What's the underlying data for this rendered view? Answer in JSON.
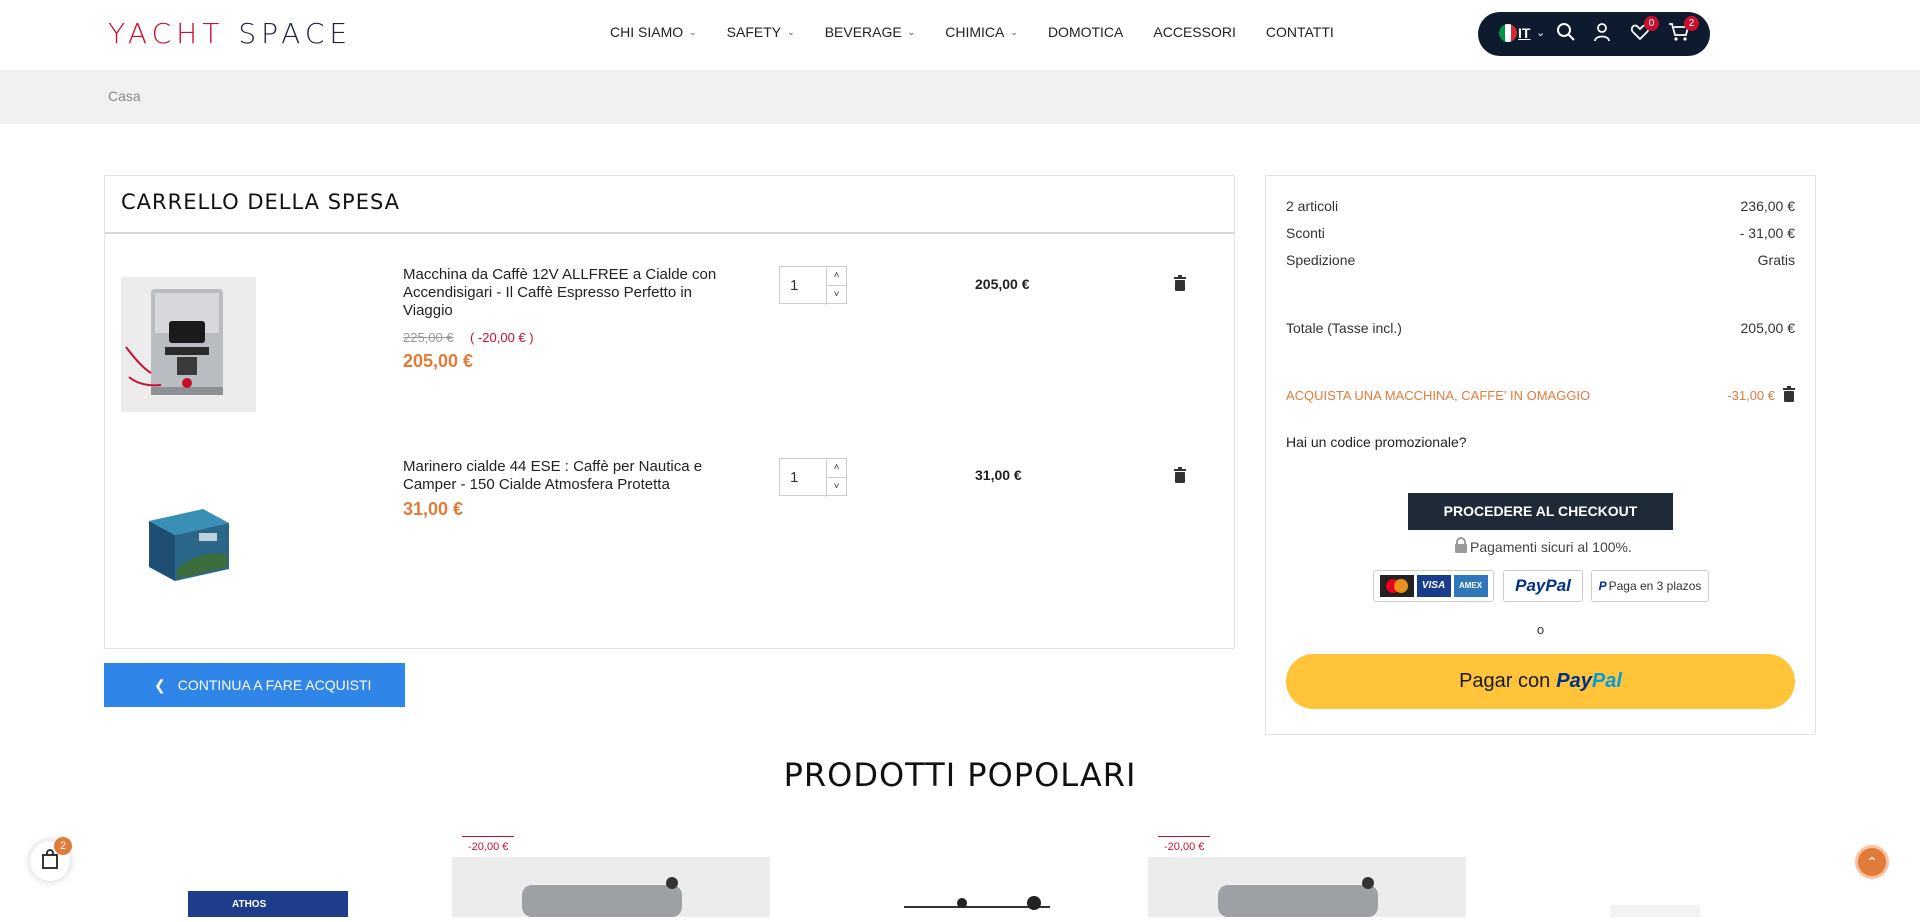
{
  "header": {
    "logo_part1": "YACHT",
    "logo_part2": "SPACE",
    "nav": [
      {
        "label": "CHI SIAMO",
        "dropdown": true
      },
      {
        "label": "SAFETY",
        "dropdown": true
      },
      {
        "label": "BEVERAGE",
        "dropdown": true
      },
      {
        "label": "CHIMICA",
        "dropdown": true
      },
      {
        "label": "DOMOTICA",
        "dropdown": false
      },
      {
        "label": "ACCESSORI",
        "dropdown": false
      },
      {
        "label": "CONTATTI",
        "dropdown": false
      }
    ],
    "language": "IT",
    "wishlist_count": "0",
    "cart_count": "2"
  },
  "breadcrumb": "Casa",
  "cart": {
    "title": "CARRELLO DELLA SPESA",
    "items": [
      {
        "name": "Macchina da Caffè 12V ALLFREE a Cialde con Accendisigari - Il Caffè Espresso Perfetto in Viaggio",
        "old_price": "225,00 €",
        "discount": "( -20,00 € )",
        "price": "205,00 €",
        "qty": "1",
        "total": "205,00 €"
      },
      {
        "name": "Marinero cialde 44 ESE : Caffè per Nautica e Camper - 150 Cialde Atmosfera Protetta",
        "price": "31,00 €",
        "qty": "1",
        "total": "31,00 €"
      }
    ],
    "continue_label": "CONTINUA A FARE ACQUISTI"
  },
  "summary": {
    "items_label": "2 articoli",
    "items_value": "236,00 €",
    "discount_label": "Sconti",
    "discount_value": "- 31,00 €",
    "shipping_label": "Spedizione",
    "shipping_value": "Gratis",
    "total_label": "Totale (Tasse incl.)",
    "total_value": "205,00 €",
    "promo_name": "ACQUISTA UNA MACCHINA, CAFFE' IN OMAGGIO",
    "promo_value": "-31,00 €",
    "promo_question": "Hai un codice promozionale?",
    "checkout_label": "PROCEDERE AL CHECKOUT",
    "secure_text": "Pagamenti sicuri al 100%.",
    "paypal_logo": "PayPal",
    "paypal_installments": "Paga en 3 plazos",
    "or_text": "o",
    "paypal_button_text": "Pagar con",
    "paypal_pay": "Pay",
    "paypal_pal": "Pal"
  },
  "popular": {
    "title": "PRODOTTI POPOLARI",
    "tags": [
      "-20,00 €",
      "-20,00 €"
    ]
  },
  "floating_cart_count": "2",
  "colors": {
    "brand_red": "#c8102e",
    "brand_navy": "#0e1a2e",
    "accent_orange": "#e07b39",
    "continue_blue": "#2f86e8",
    "paypal_yellow": "#ffc439"
  }
}
